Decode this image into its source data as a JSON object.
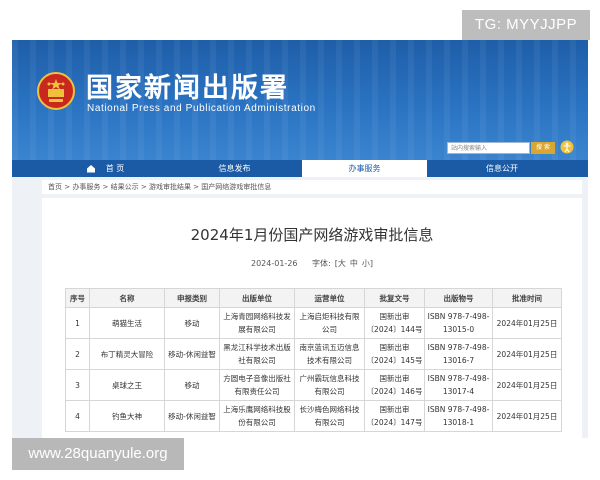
{
  "watermarks": {
    "top": "TG: MYYJJPP",
    "bottom": "www.28quanyule.org"
  },
  "header": {
    "site_name": "国家新闻出版署",
    "site_name_en": "National Press and Publication Administration",
    "search_placeholder": "站内搜索输入",
    "search_button": "搜 索"
  },
  "nav": {
    "items": [
      {
        "label": "首 页"
      },
      {
        "label": "信息发布"
      },
      {
        "label": "办事服务"
      },
      {
        "label": "信息公开"
      }
    ],
    "active_index": 2
  },
  "breadcrumb": "首页 > 办事服务 > 结果公示 > 游戏审批结果 > 国产网络游戏审批信息",
  "article": {
    "title": "2024年1月份国产网络游戏审批信息",
    "date": "2024-01-26",
    "font_label": "字体:",
    "font_sizes": [
      "[大",
      "中",
      "小]"
    ]
  },
  "table": {
    "headers": [
      "序号",
      "名称",
      "申报类别",
      "出版单位",
      "运营单位",
      "批复文号",
      "出版物号",
      "批准时间"
    ],
    "rows": [
      [
        "1",
        "萌猫生活",
        "移动",
        "上海青园网络科技发展有限公司",
        "上海启炬科技有限公司",
        "国新出审〔2024〕144号",
        "ISBN 978-7-498-13015-0",
        "2024年01月25日"
      ],
      [
        "2",
        "布丁精灵大冒险",
        "移动-休闲益智",
        "黑龙江科学技术出版社有限公司",
        "南京蓝讯五迈信息技术有限公司",
        "国新出审〔2024〕145号",
        "ISBN 978-7-498-13016-7",
        "2024年01月25日"
      ],
      [
        "3",
        "桌球之王",
        "移动",
        "方圆电子音像出版社有限责任公司",
        "广州霸玩信息科技有限公司",
        "国新出审〔2024〕146号",
        "ISBN 978-7-498-13017-4",
        "2024年01月25日"
      ],
      [
        "4",
        "钓鱼大神",
        "移动-休闲益智",
        "上海乐鹰网络科技股份有限公司",
        "长沙梅色网络科技有限公司",
        "国新出审〔2024〕147号",
        "ISBN 978-7-498-13018-1",
        "2024年01月25日"
      ]
    ]
  },
  "colors": {
    "banner": "#2a6db8",
    "nav": "#1b5aa5",
    "search_button": "#d8a633"
  }
}
